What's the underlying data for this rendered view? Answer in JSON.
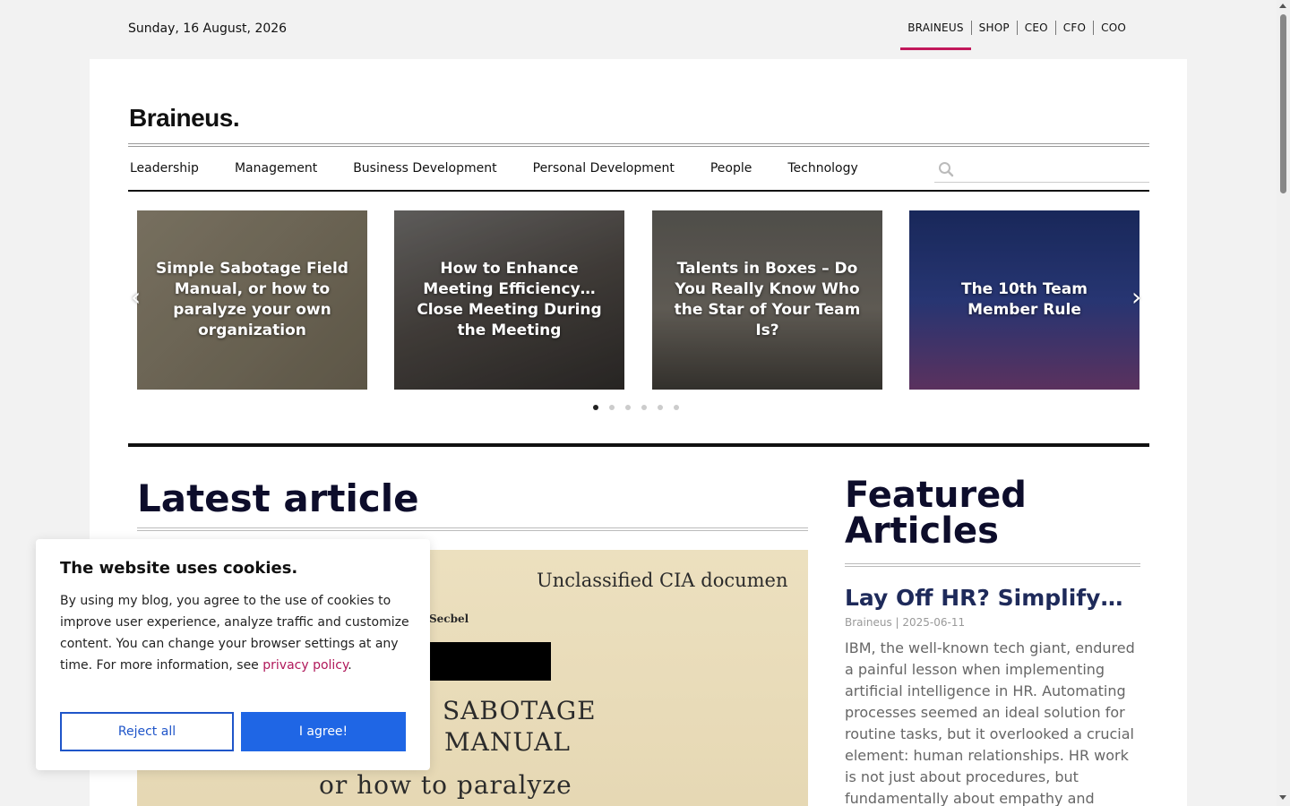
{
  "topbar": {
    "date": "Sunday, 16 August, 2026",
    "links": [
      "BRAINEUS",
      "SHOP",
      "CEO",
      "CFO",
      "COO"
    ],
    "active_link": "BRAINEUS",
    "accent_color": "#c2185b"
  },
  "header": {
    "logo": "Braineus."
  },
  "nav": {
    "items": [
      "Leadership",
      "Management",
      "Business Development",
      "Personal Development",
      "People",
      "Technology"
    ],
    "search_icon": "search-icon",
    "search_placeholder": ""
  },
  "carousel": {
    "slides": [
      {
        "title": "Simple Sabotage Field Manual, or how to paralyze your own organization"
      },
      {
        "title": "How to Enhance Meeting Efficiency… Close Meeting During the Meeting"
      },
      {
        "title": "Talents in Boxes – Do You Really Know Who the Star of Your Team Is?"
      },
      {
        "title": "The 10th Team Member Rule"
      }
    ],
    "prev_icon": "chevron-left-icon",
    "next_icon": "chevron-right-icon",
    "dot_count": 6,
    "active_dot": 0
  },
  "latest": {
    "heading": "Latest article",
    "image_text": {
      "line1": "Unclassified CIA documen",
      "line2": "Secbel",
      "line3": "SABOTAGE",
      "line4": "MANUAL",
      "line5": "or how to paralyze"
    }
  },
  "featured": {
    "heading": "Featured Articles",
    "article": {
      "title": "Lay Off HR? Simplify…",
      "meta": "Braineus | 2025-06-11",
      "excerpt": "IBM, the well-known tech giant, endured a painful lesson when implementing artificial intelligence in HR. Automating processes seemed an ideal solution for routine tasks, but it overlooked a crucial element: human relationships. HR work is not just about procedures, but fundamentally about empathy and"
    }
  },
  "cookie": {
    "title": "The website uses cookies.",
    "body": "By using my blog, you agree to the use of cookies to improve user experience, analyze traffic and customize content. You can change your browser settings at any time. For more information, see",
    "link_text": "privacy policy",
    "period": ".",
    "reject_label": "Reject all",
    "agree_label": "I agree!",
    "button_color": "#1f66e5"
  }
}
